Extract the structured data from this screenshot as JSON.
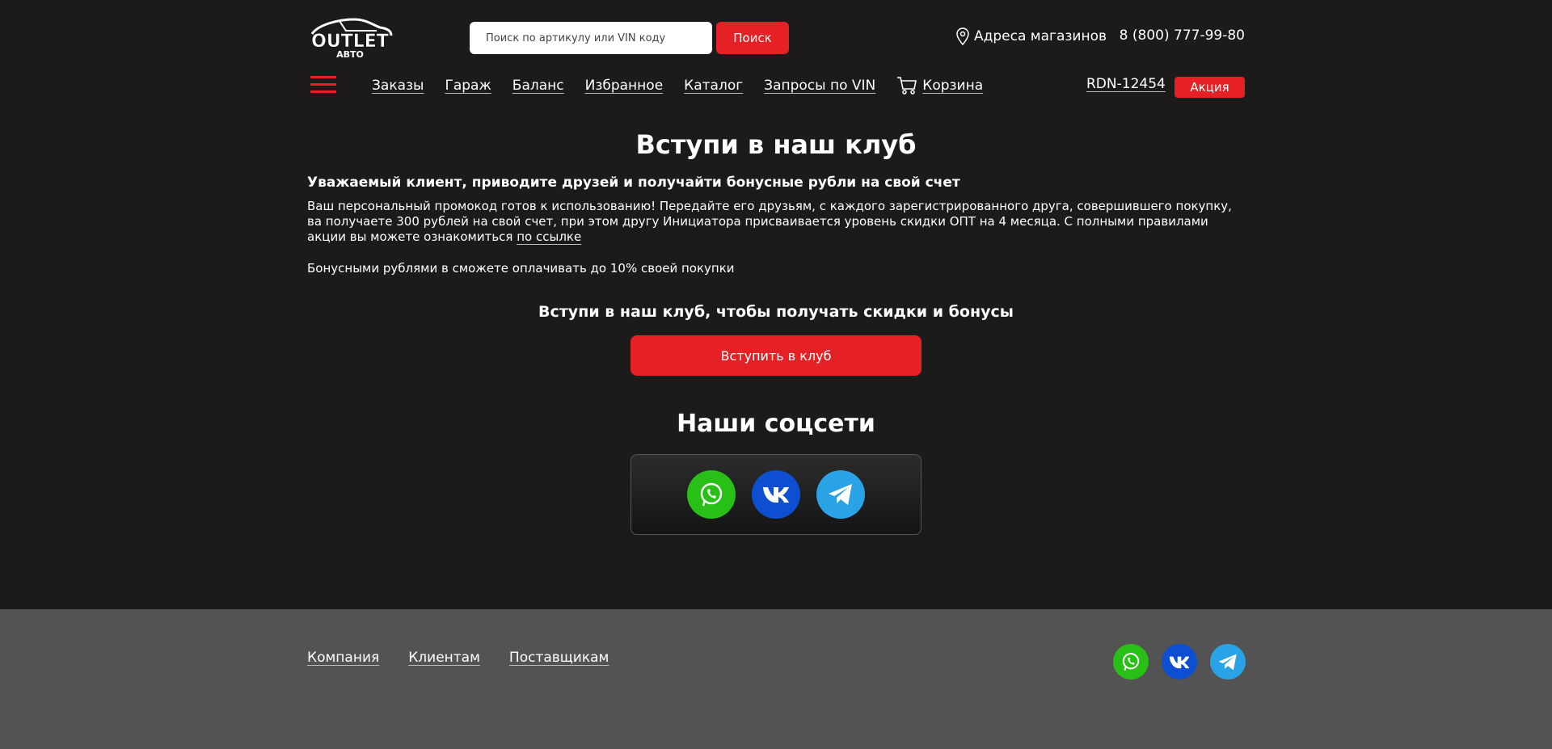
{
  "header": {
    "logo_text": "OUTLET",
    "logo_sub": "АВТО",
    "search_placeholder": "Поиск по артикулу или VIN коду",
    "search_button": "Поиск",
    "stores_label": "Адреса магазинов",
    "phone": "8 (800) 777-99-80"
  },
  "nav": {
    "items": [
      "Заказы",
      "Гараж",
      "Баланс",
      "Избранное",
      "Каталог",
      "Запросы по VIN"
    ],
    "cart_label": "Корзина",
    "account_id": "RDN-12454",
    "promo_label": "Акция"
  },
  "main": {
    "title": "Вступи в наш клуб",
    "subtitle": "Уважаемый клиент, приводите друзей и получайти бонусные рубли на свой счет",
    "paragraph": "Ваш персональный промокод готов к использованию! Передайте его друзьям, с каждого зарегистрированного друга, совершившего покупку, ва получаете 300 рублей на свой счет, при этом другу Инициатора присваивается уровень скидки ОПТ на 4 месяца. С полными правилами акции вы можете ознакомиться",
    "rules_link": "по ссылке",
    "bonus_note": "Бонусными рублями в сможете оплачивать до 10% своей покупки",
    "join_title": "Вступи в наш клуб, чтобы получать скидки и бонусы",
    "join_button": "Вступить в клуб",
    "social_title": "Наши соцсети"
  },
  "footer": {
    "links": [
      "Компания",
      "Клиентам",
      "Поставщикам"
    ]
  },
  "colors": {
    "background": "#1c1a1b",
    "accent": "#e52125",
    "footer_bg": "#535353",
    "whatsapp": "#28c016",
    "vk": "#0d4fd0",
    "telegram": "#2aa3e6"
  },
  "icons": [
    "logo-car-icon",
    "location-pin-icon",
    "cart-icon",
    "menu-icon",
    "whatsapp-icon",
    "vk-icon",
    "telegram-icon"
  ]
}
